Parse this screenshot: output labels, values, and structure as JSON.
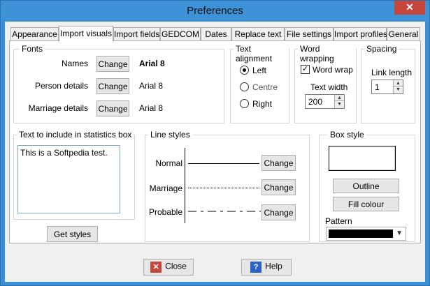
{
  "window": {
    "title": "Preferences",
    "close_glyph": "✕"
  },
  "tabs": [
    {
      "label": "Appearance"
    },
    {
      "label": "Import visuals"
    },
    {
      "label": "Import fields"
    },
    {
      "label": "GEDCOM"
    },
    {
      "label": "Dates"
    },
    {
      "label": "Replace text"
    },
    {
      "label": "File settings"
    },
    {
      "label": "Import profiles"
    },
    {
      "label": "General"
    }
  ],
  "fonts": {
    "title": "Fonts",
    "rows": [
      {
        "label": "Names",
        "button": "Change",
        "value": "Arial 8"
      },
      {
        "label": "Person details",
        "button": "Change",
        "value": "Arial 8"
      },
      {
        "label": "Marriage details",
        "button": "Change",
        "value": "Arial 8"
      }
    ]
  },
  "text_alignment": {
    "title": "Text alignment",
    "options": [
      "Left",
      "Centre",
      "Right"
    ],
    "selected": "Left"
  },
  "word_wrapping": {
    "title": "Word wrapping",
    "checkbox_label": "Word wrap",
    "checked": true,
    "text_width_label": "Text width",
    "text_width_value": "200"
  },
  "spacing": {
    "title": "Spacing",
    "link_length_label": "Link length",
    "link_length_value": "1"
  },
  "statistics": {
    "title": "Text to include in statistics box",
    "text": "This is a Softpedia test.",
    "get_styles_button": "Get styles"
  },
  "line_styles": {
    "title": "Line styles",
    "rows": [
      {
        "label": "Normal",
        "button": "Change"
      },
      {
        "label": "Marriage",
        "button": "Change"
      },
      {
        "label": "Probable",
        "button": "Change"
      }
    ]
  },
  "box_style": {
    "title": "Box style",
    "outline_button": "Outline",
    "fill_button": "Fill colour",
    "pattern_label": "Pattern",
    "pattern_color": "#000000"
  },
  "footer": {
    "close_button": "Close",
    "help_button": "Help",
    "help_glyph": "?",
    "close_glyph": "✕"
  },
  "colors": {
    "titlebar": "#3d92d8",
    "close_red": "#c7463c",
    "help_blue": "#2a62c9"
  }
}
